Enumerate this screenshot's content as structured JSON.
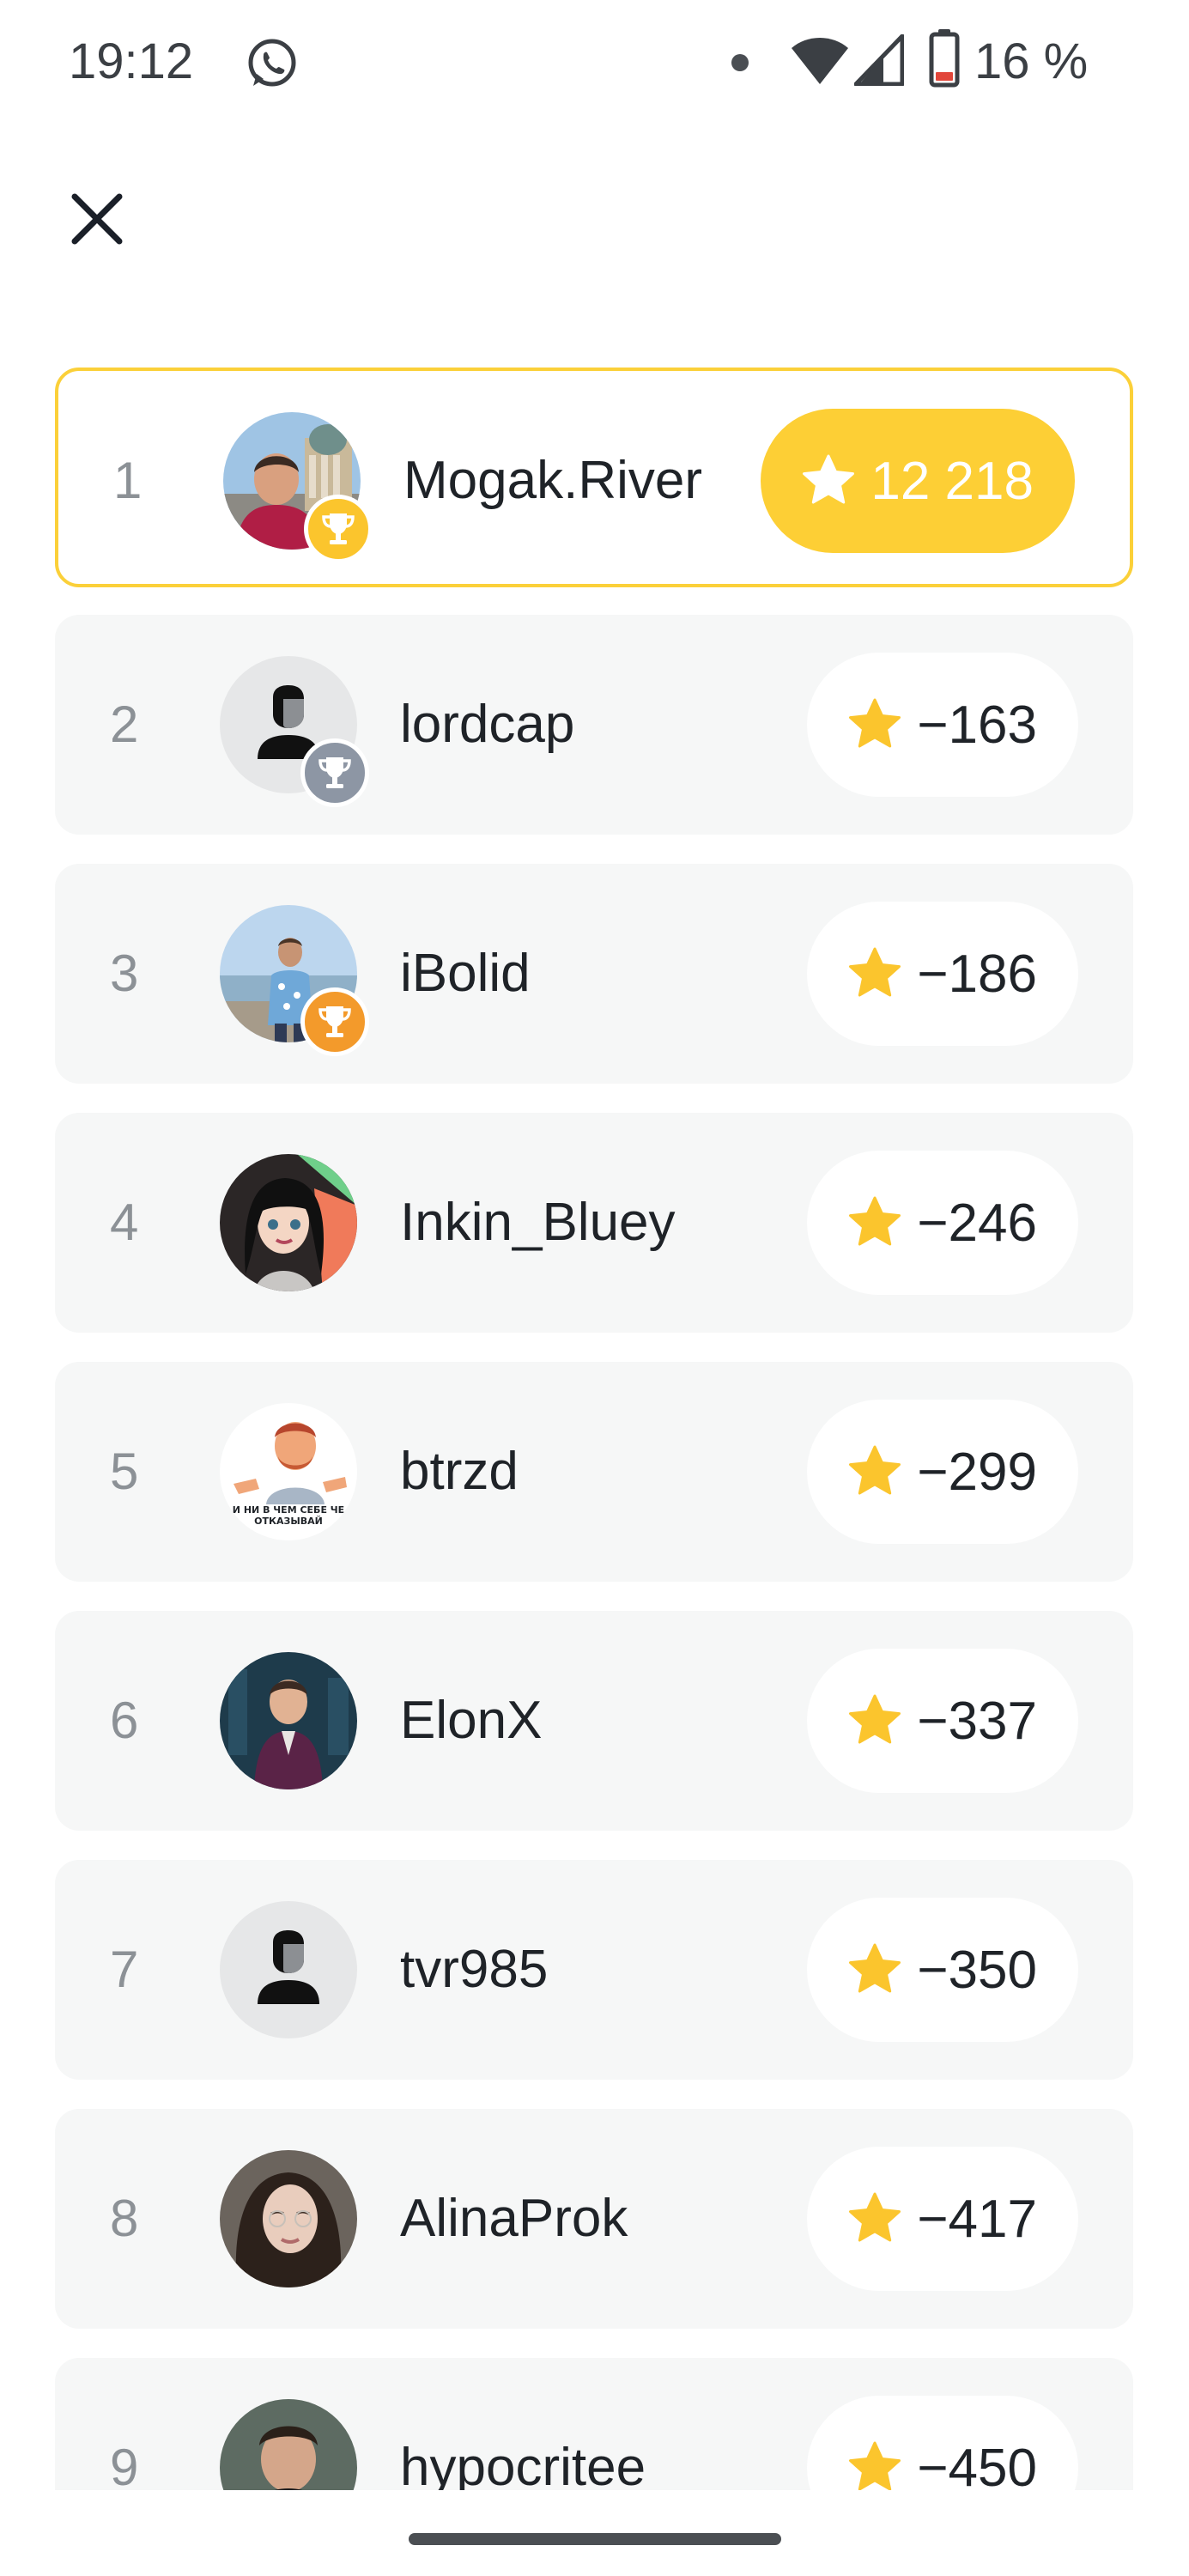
{
  "status_bar": {
    "time": "19:12",
    "app_icon": "whatsapp-icon",
    "battery_text": "16 %",
    "icons": [
      "dot-icon",
      "wifi-icon",
      "signal-icon",
      "battery-icon"
    ]
  },
  "header": {
    "close_icon": "close-icon"
  },
  "colors": {
    "accent": "#fdcf35",
    "gold": "#fbc52d",
    "silver": "#8d96a4",
    "bronze": "#f39a2b",
    "row_bg": "#f6f7f7",
    "rank_text": "#8c9196"
  },
  "leaderboard": {
    "rows": [
      {
        "rank": "1",
        "name": "Mogak.River",
        "score": "12 218",
        "trophy": "gold",
        "avatar": "photo-avatar"
      },
      {
        "rank": "2",
        "name": "lordcap",
        "score": "−163",
        "trophy": "silver",
        "avatar": "default-avatar"
      },
      {
        "rank": "3",
        "name": "iBolid",
        "score": "−186",
        "trophy": "bronze",
        "avatar": "photo-avatar"
      },
      {
        "rank": "4",
        "name": "Inkin_Bluey",
        "score": "−246",
        "trophy": "",
        "avatar": "illustrated-avatar"
      },
      {
        "rank": "5",
        "name": "btrzd",
        "score": "−299",
        "trophy": "",
        "avatar": "sticker-avatar",
        "avatar_caption": "И НИ В ЧЕМ СЕБЕ ЧЕ ОТКАЗЫВАЙ"
      },
      {
        "rank": "6",
        "name": "ElonX",
        "score": "−337",
        "trophy": "",
        "avatar": "illustrated-avatar"
      },
      {
        "rank": "7",
        "name": "tvr985",
        "score": "−350",
        "trophy": "",
        "avatar": "default-avatar"
      },
      {
        "rank": "8",
        "name": "AlinaProk",
        "score": "−417",
        "trophy": "",
        "avatar": "photo-avatar"
      },
      {
        "rank": "9",
        "name": "hypocritee",
        "score": "−450",
        "trophy": "",
        "avatar": "photo-avatar"
      }
    ]
  }
}
